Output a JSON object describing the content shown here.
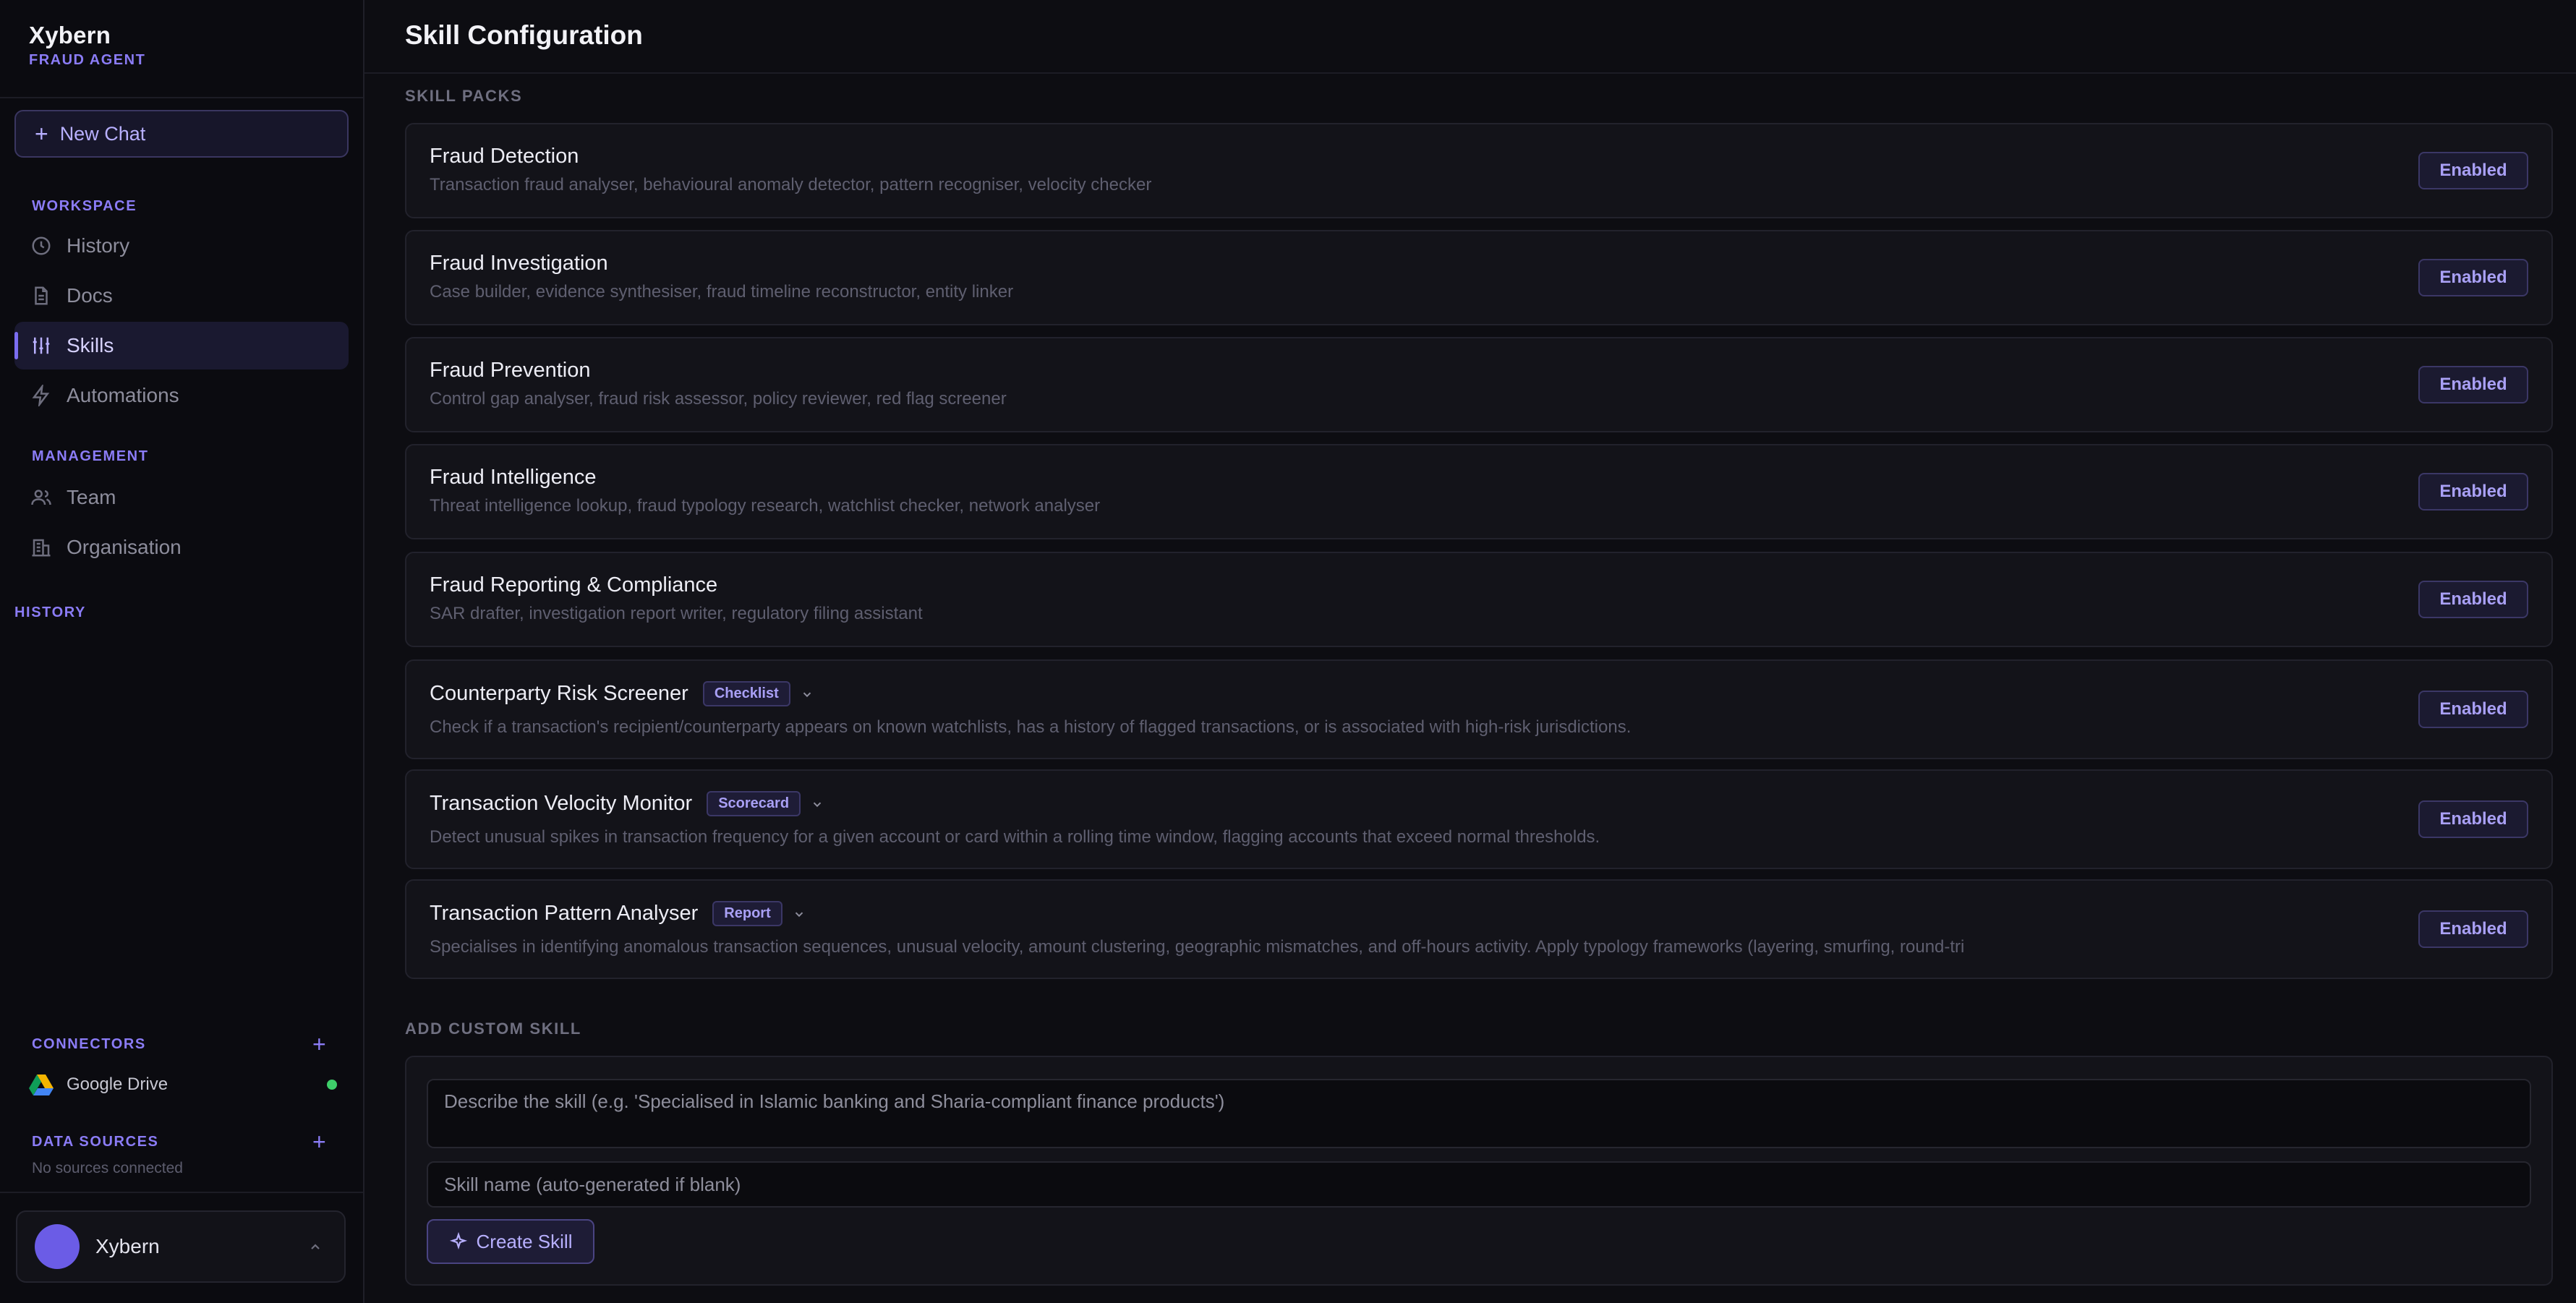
{
  "brand": {
    "name": "Xybern",
    "subtitle": "FRAUD AGENT"
  },
  "sidebar": {
    "new_chat_label": "New Chat",
    "workspace_label": "WORKSPACE",
    "workspace_items": [
      {
        "label": "History",
        "icon": "clock-icon"
      },
      {
        "label": "Docs",
        "icon": "document-icon"
      },
      {
        "label": "Skills",
        "icon": "sliders-icon",
        "active": true
      },
      {
        "label": "Automations",
        "icon": "lightning-icon"
      }
    ],
    "management_label": "MANAGEMENT",
    "management_items": [
      {
        "label": "Team",
        "icon": "users-icon"
      },
      {
        "label": "Organisation",
        "icon": "building-icon"
      }
    ],
    "history_label": "HISTORY",
    "connectors_label": "CONNECTORS",
    "connectors": [
      {
        "label": "Google Drive",
        "icon": "google-drive-icon",
        "status_color": "#3ecf6a"
      }
    ],
    "data_sources_label": "DATA SOURCES",
    "data_sources_empty": "No sources connected",
    "user": {
      "name": "Xybern"
    }
  },
  "main": {
    "title": "Skill Configuration",
    "skill_packs_label": "SKILL PACKS",
    "skills": [
      {
        "title": "Fraud Detection",
        "desc": "Transaction fraud analyser, behavioural anomaly detector, pattern recogniser, velocity checker",
        "status": "Enabled"
      },
      {
        "title": "Fraud Investigation",
        "desc": "Case builder, evidence synthesiser, fraud timeline reconstructor, entity linker",
        "status": "Enabled"
      },
      {
        "title": "Fraud Prevention",
        "desc": "Control gap analyser, fraud risk assessor, policy reviewer, red flag screener",
        "status": "Enabled"
      },
      {
        "title": "Fraud Intelligence",
        "desc": "Threat intelligence lookup, fraud typology research, watchlist checker, network analyser",
        "status": "Enabled"
      },
      {
        "title": "Fraud Reporting & Compliance",
        "desc": "SAR drafter, investigation report writer, regulatory filing assistant",
        "status": "Enabled"
      },
      {
        "title": "Counterparty Risk Screener",
        "badge": "Checklist",
        "desc": "Check if a transaction's recipient/counterparty appears on known watchlists, has a history of flagged transactions, or is associated with high-risk jurisdictions.",
        "status": "Enabled"
      },
      {
        "title": "Transaction Velocity Monitor",
        "badge": "Scorecard",
        "desc": "Detect unusual spikes in transaction frequency for a given account or card within a rolling time window, flagging accounts that exceed normal thresholds.",
        "status": "Enabled"
      },
      {
        "title": "Transaction Pattern Analyser",
        "badge": "Report",
        "desc": "Specialises in identifying anomalous transaction sequences, unusual velocity, amount clustering, geographic mismatches, and off-hours activity. Apply typology frameworks (layering, smurfing, round-tri",
        "status": "Enabled"
      }
    ],
    "add_custom_label": "ADD CUSTOM SKILL",
    "custom": {
      "description_placeholder": "Describe the skill (e.g. 'Specialised in Islamic banking and Sharia-compliant finance products')",
      "name_placeholder": "Skill name (auto-generated if blank)",
      "create_label": "Create Skill"
    }
  },
  "colors": {
    "accent": "#8b7cf6",
    "background": "#0d0d12",
    "card": "#131319",
    "status_online": "#3ecf6a"
  }
}
